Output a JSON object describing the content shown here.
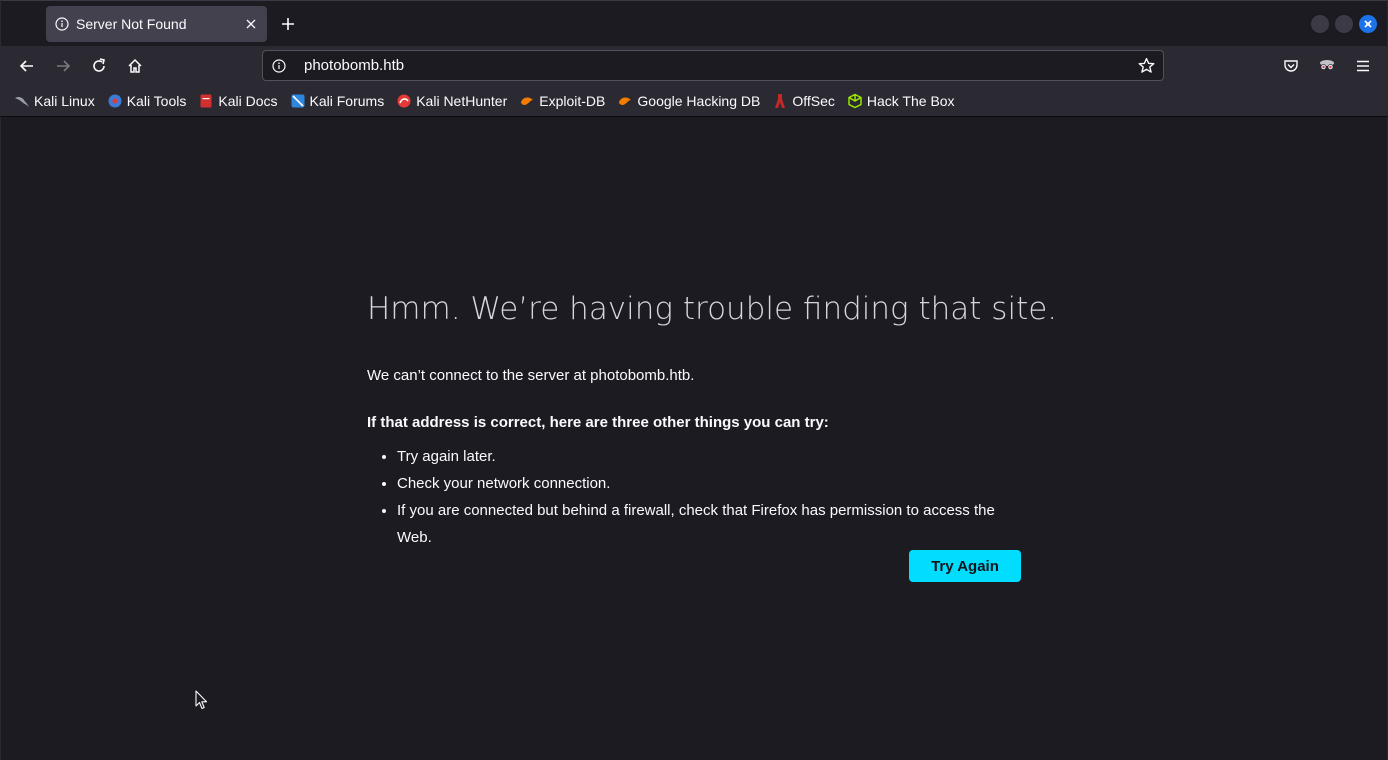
{
  "tab": {
    "title": "Server Not Found"
  },
  "url": {
    "value": "photobomb.htb"
  },
  "bookmarks": [
    {
      "label": "Kali Linux",
      "icon": "kali-dragon-icon",
      "color": "#9aa0a6"
    },
    {
      "label": "Kali Tools",
      "icon": "kali-tools-icon",
      "color": "#3a7bd5"
    },
    {
      "label": "Kali Docs",
      "icon": "kali-docs-icon",
      "color": "#d32f2f"
    },
    {
      "label": "Kali Forums",
      "icon": "kali-forums-icon",
      "color": "#2e86de"
    },
    {
      "label": "Kali NetHunter",
      "icon": "kali-nethunter-icon",
      "color": "#e53935"
    },
    {
      "label": "Exploit-DB",
      "icon": "exploit-db-icon",
      "color": "#f57c00"
    },
    {
      "label": "Google Hacking DB",
      "icon": "ghdb-icon",
      "color": "#f57c00"
    },
    {
      "label": "OffSec",
      "icon": "offsec-icon",
      "color": "#c62828"
    },
    {
      "label": "Hack The Box",
      "icon": "hack-the-box-icon",
      "color": "#9fef00"
    }
  ],
  "error": {
    "title": "Hmm. We’re having trouble finding that site.",
    "description": "We can’t connect to the server at photobomb.htb.",
    "strong": "If that address is correct, here are three other things you can try:",
    "items": [
      "Try again later.",
      "Check your network connection.",
      "If you are connected but behind a firewall, check that Firefox has permission to access the Web."
    ],
    "button": "Try Again"
  },
  "colors": {
    "accent": "#00ddff",
    "background": "#1c1b22",
    "toolbar": "#2b2a33"
  }
}
